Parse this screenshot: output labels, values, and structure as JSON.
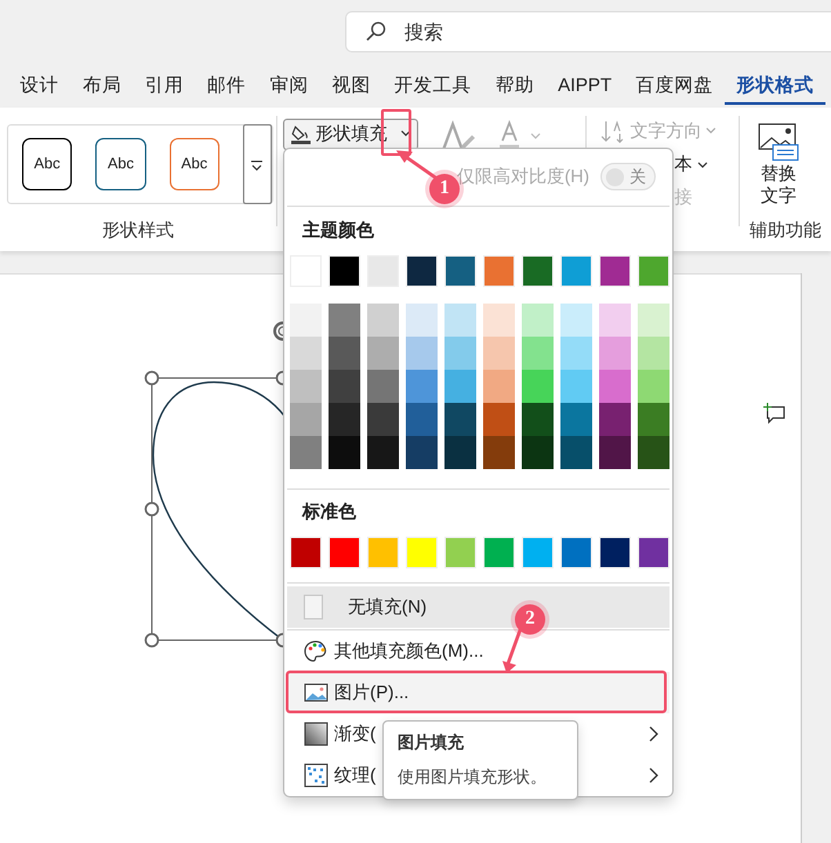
{
  "search": {
    "placeholder": "搜索"
  },
  "tabs": [
    {
      "label": "设计",
      "selected": false
    },
    {
      "label": "布局",
      "selected": false
    },
    {
      "label": "引用",
      "selected": false
    },
    {
      "label": "邮件",
      "selected": false
    },
    {
      "label": "审阅",
      "selected": false
    },
    {
      "label": "视图",
      "selected": false
    },
    {
      "label": "开发工具",
      "selected": false
    },
    {
      "label": "帮助",
      "selected": false
    },
    {
      "label": "AIPPT",
      "selected": false
    },
    {
      "label": "百度网盘",
      "selected": false
    },
    {
      "label": "形状格式",
      "selected": true
    }
  ],
  "ribbon": {
    "shape_styles": [
      {
        "label": "Abc",
        "color": "#000000"
      },
      {
        "label": "Abc",
        "color": "#156082"
      },
      {
        "label": "Abc",
        "color": "#e97132"
      }
    ],
    "shape_styles_label": "形状样式",
    "shape_fill_button": "形状填充",
    "text_direction": "文字方向",
    "text_cut": "本",
    "link_cut": "接",
    "alt_text_button": "替换文字",
    "accessibility_label": "辅助功能"
  },
  "menu": {
    "high_contrast": {
      "label": "仅限高对比度(H)",
      "value": "关",
      "on": false
    },
    "theme_title": "主题颜色",
    "theme_colors": [
      {
        "color": "#ffffff",
        "shades": [
          {
            "color": "#f2f2f2"
          },
          {
            "color": "#d9d9d9"
          },
          {
            "color": "#bfbfbf"
          },
          {
            "color": "#a6a6a6"
          },
          {
            "color": "#808080"
          }
        ]
      },
      {
        "color": "#000000",
        "shades": [
          {
            "color": "#808080"
          },
          {
            "color": "#595959"
          },
          {
            "color": "#404040"
          },
          {
            "color": "#262626"
          },
          {
            "color": "#0d0d0d"
          }
        ]
      },
      {
        "color": "#e8e8e8",
        "shades": [
          {
            "color": "#d0d0d0"
          },
          {
            "color": "#adadad"
          },
          {
            "color": "#757575"
          },
          {
            "color": "#3a3a3a"
          },
          {
            "color": "#171717"
          }
        ]
      },
      {
        "color": "#0e2841",
        "shades": [
          {
            "color": "#dceaf7"
          },
          {
            "color": "#a6c9ec"
          },
          {
            "color": "#4e95d9"
          },
          {
            "color": "#215f9a"
          },
          {
            "color": "#153d64"
          }
        ]
      },
      {
        "color": "#156082",
        "shades": [
          {
            "color": "#c1e4f5"
          },
          {
            "color": "#83cbeb"
          },
          {
            "color": "#45b0e1"
          },
          {
            "color": "#104862"
          },
          {
            "color": "#0a3041"
          }
        ]
      },
      {
        "color": "#e97132",
        "shades": [
          {
            "color": "#fbe2d5"
          },
          {
            "color": "#f6c6ad"
          },
          {
            "color": "#f1a983"
          },
          {
            "color": "#c04f15"
          },
          {
            "color": "#843c0c"
          }
        ]
      },
      {
        "color": "#196b24",
        "shades": [
          {
            "color": "#c1f0c8"
          },
          {
            "color": "#83e28e"
          },
          {
            "color": "#47d459"
          },
          {
            "color": "#124f1a"
          },
          {
            "color": "#0c3512"
          }
        ]
      },
      {
        "color": "#0f9ed5",
        "shades": [
          {
            "color": "#caedfb"
          },
          {
            "color": "#94dcf8"
          },
          {
            "color": "#61cbf3"
          },
          {
            "color": "#0b769f"
          },
          {
            "color": "#074f6a"
          }
        ]
      },
      {
        "color": "#a02b93",
        "shades": [
          {
            "color": "#f2ceef"
          },
          {
            "color": "#e59edd"
          },
          {
            "color": "#d86dcd"
          },
          {
            "color": "#782170"
          },
          {
            "color": "#511548"
          }
        ]
      },
      {
        "color": "#4ea72e",
        "shades": [
          {
            "color": "#d9f2d0"
          },
          {
            "color": "#b4e5a2"
          },
          {
            "color": "#8ed973"
          },
          {
            "color": "#3b7d23"
          },
          {
            "color": "#275317"
          }
        ]
      }
    ],
    "standard_title": "标准色",
    "standard_colors": [
      {
        "color": "#c00000"
      },
      {
        "color": "#ff0000"
      },
      {
        "color": "#ffc000"
      },
      {
        "color": "#ffff00"
      },
      {
        "color": "#92d050"
      },
      {
        "color": "#00b050"
      },
      {
        "color": "#00b0f0"
      },
      {
        "color": "#0070c0"
      },
      {
        "color": "#002060"
      },
      {
        "color": "#7030a0"
      }
    ],
    "items": [
      {
        "kind": "none",
        "label": "无填充(N)",
        "highlighted": true,
        "submenu": false
      },
      {
        "kind": "palette",
        "label": "其他填充颜色(M)...",
        "highlighted": false,
        "submenu": false
      },
      {
        "kind": "picture",
        "label": "图片(P)...",
        "highlighted": true,
        "submenu": false
      },
      {
        "kind": "gradient",
        "label": "渐变(",
        "highlighted": false,
        "submenu": true
      },
      {
        "kind": "texture",
        "label": "纹理(",
        "highlighted": false,
        "submenu": true
      }
    ]
  },
  "tooltip": {
    "title": "图片填充",
    "text": "使用图片填充形状。"
  },
  "annotations": [
    {
      "label": "1"
    },
    {
      "label": "2"
    }
  ]
}
